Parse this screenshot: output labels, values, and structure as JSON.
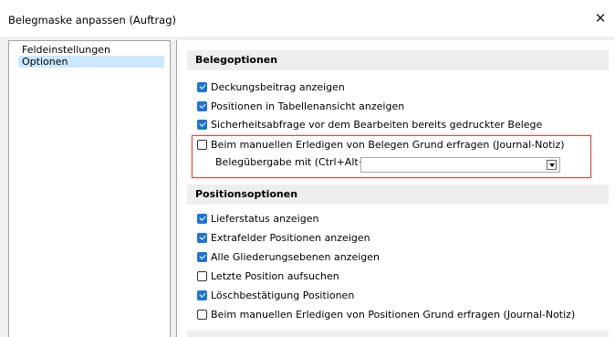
{
  "window": {
    "title": "Belegmaske anpassen (Auftrag)",
    "close_glyph": "✕"
  },
  "tree": {
    "items": [
      {
        "label": "Feldeinstellungen",
        "selected": false
      },
      {
        "label": "Optionen",
        "selected": true
      }
    ]
  },
  "belegoptionen": {
    "header": "Belegoptionen",
    "options": [
      {
        "label": "Deckungsbeitrag anzeigen",
        "checked": true
      },
      {
        "label": "Positionen in Tabellenansicht anzeigen",
        "checked": true
      },
      {
        "label": "Sicherheitsabfrage vor dem Bearbeiten bereits gedruckter Belege",
        "checked": true
      },
      {
        "label": "Beim manuellen Erledigen von Belegen Grund erfragen (Journal-Notiz)",
        "checked": false
      }
    ],
    "belegubergabe_label": "Belegübergabe mit  (Ctrl+Alt+U)",
    "belegubergabe_value": ""
  },
  "positionsoptionen": {
    "header": "Positionsoptionen",
    "options": [
      {
        "label": "Lieferstatus anzeigen",
        "checked": true
      },
      {
        "label": "Extrafelder Positionen anzeigen",
        "checked": true
      },
      {
        "label": "Alle Gliederungsebenen anzeigen",
        "checked": true
      },
      {
        "label": "Letzte Position aufsuchen",
        "checked": false
      },
      {
        "label": "Löschbestätigung Positionen",
        "checked": true
      },
      {
        "label": "Beim manuellen Erledigen von Positionen Grund erfragen (Journal-Notiz)",
        "checked": false
      }
    ]
  },
  "colors": {
    "accent": "#1e74d2",
    "highlight_border": "#d64541",
    "selection": "#cce8ff"
  }
}
